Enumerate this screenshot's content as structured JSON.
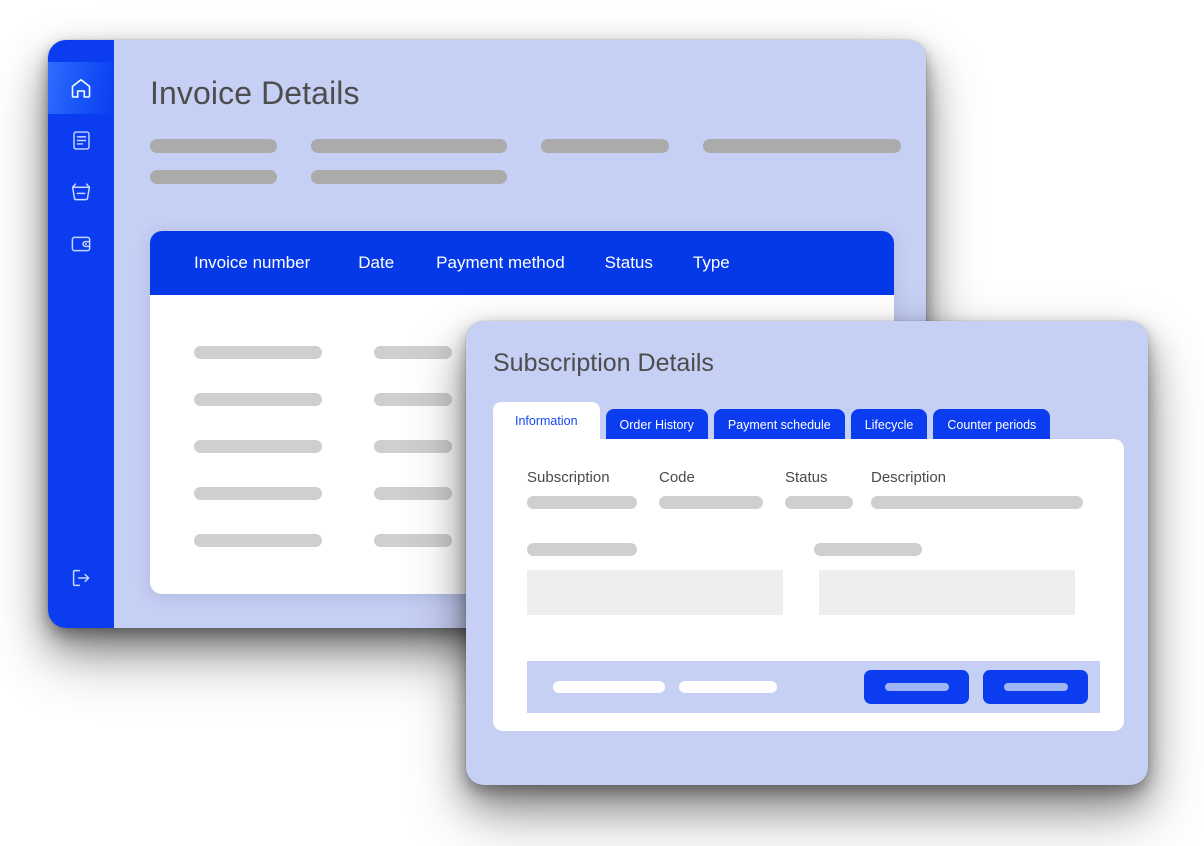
{
  "invoice_window": {
    "title": "Invoice Details",
    "sidebar": {
      "background_color": "#0B3CF0",
      "items": [
        {
          "id": "home",
          "icon": "home-icon",
          "label": "Home",
          "active": true
        },
        {
          "id": "documents",
          "icon": "document-icon",
          "label": "Documents",
          "active": false
        },
        {
          "id": "orders",
          "icon": "basket-icon",
          "label": "Orders",
          "active": false
        },
        {
          "id": "billing",
          "icon": "wallet-icon",
          "label": "Billing",
          "active": false
        }
      ],
      "footer_item": {
        "id": "logout",
        "icon": "logout-icon",
        "label": "Log out"
      }
    },
    "meta_placeholders": {
      "row1_widths": [
        127,
        196,
        128,
        198
      ],
      "row2_widths": [
        127,
        196
      ]
    },
    "table": {
      "header_color": "#0539E8",
      "columns": [
        "Invoice number",
        "Date",
        "Payment method",
        "Status",
        "Type"
      ],
      "column_gaps": [
        48,
        42,
        40,
        40
      ],
      "row_count": 5,
      "row_placeholder_widths": [
        128,
        78
      ]
    }
  },
  "subscription_window": {
    "title": "Subscription Details",
    "tabs": [
      {
        "label": "Information",
        "active": true
      },
      {
        "label": "Order History",
        "active": false
      },
      {
        "label": "Payment schedule",
        "active": false
      },
      {
        "label": "Lifecycle",
        "active": false
      },
      {
        "label": "Counter periods",
        "active": false
      }
    ],
    "fields": {
      "labels": [
        "Subscription",
        "Code",
        "Status",
        "Description"
      ],
      "value_placeholder_widths": [
        110,
        104,
        68,
        212
      ]
    },
    "second_row_placeholder_widths": [
      110,
      108
    ],
    "inputs": [
      {
        "name": "field-box-left",
        "value": "",
        "placeholder": ""
      },
      {
        "name": "field-box-right",
        "value": "",
        "placeholder": ""
      }
    ],
    "footer": {
      "background_color": "#C6CFF4",
      "link_placeholder_widths": [
        112,
        98
      ],
      "buttons": [
        {
          "name": "primary-action-button",
          "label": "",
          "color": "#0B3CF0",
          "width": 105
        },
        {
          "name": "secondary-action-button",
          "label": "",
          "color": "#0B3CF0",
          "width": 105
        }
      ]
    }
  },
  "palette": {
    "window_background": "#C6CFF4",
    "sidebar_blue": "#0B3CF0",
    "table_header_blue": "#0539E8",
    "card_white": "#FFFFFF",
    "skeleton_gray": "#ABABAB",
    "skeleton_light_gray": "#CFCFCF",
    "input_gray": "#EEEEEE",
    "title_text": "#4D4D4D",
    "active_tab_text": "#1848EF"
  }
}
